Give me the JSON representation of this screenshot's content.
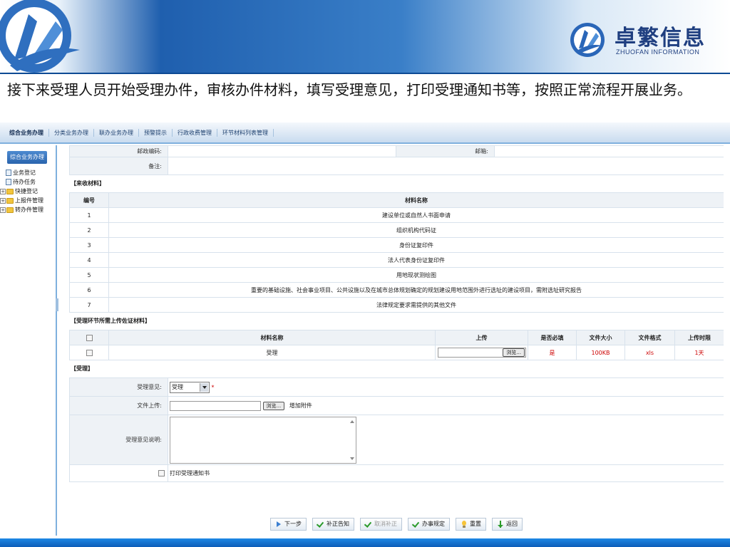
{
  "slide": {
    "brand_cn": "卓繁信息",
    "brand_en": "ZHUOFAN INFORMATION",
    "caption": "接下来受理人员开始受理办件，审核办件材料，填写受理意见，打印受理通知书等，按照正常流程开展业务。"
  },
  "topnav": {
    "items": [
      "综合业务办理",
      "分类业务办理",
      "联办业务办理",
      "预警提示",
      "行政收费管理",
      "环节材料列表管理"
    ]
  },
  "sidebar": {
    "title": "综合业务办理",
    "items": [
      {
        "label": "业务登记"
      },
      {
        "label": "待办任务"
      },
      {
        "label": "快捷登记"
      },
      {
        "label": "上报件管理"
      },
      {
        "label": "转办件管理"
      }
    ]
  },
  "form_top": {
    "postcode_label": "邮政编码:",
    "email_label": "邮箱:",
    "remark_label": "备注:"
  },
  "received_materials": {
    "section_title": "【来收材料】",
    "col_no": "编号",
    "col_name": "材料名称",
    "rows": [
      {
        "no": "1",
        "name": "建设单位或自然人书面申请"
      },
      {
        "no": "2",
        "name": "组织机构代码证"
      },
      {
        "no": "3",
        "name": "身份证复印件"
      },
      {
        "no": "4",
        "name": "法人代表身份证复印件"
      },
      {
        "no": "5",
        "name": "用地现状测绘图"
      },
      {
        "no": "6",
        "name": "重要的基础设施、社会事业项目、公共设施以及在城市总体规划确定的规划建设用地范围外进行选址的建设项目，需附选址研究报告"
      },
      {
        "no": "7",
        "name": "法律规定要求需提供的其他文件"
      }
    ]
  },
  "upload_materials": {
    "section_title": "【受理环节所需上传佐证材料】",
    "col_name": "材料名称",
    "col_upload": "上传",
    "col_required": "是否必填",
    "col_size": "文件大小",
    "col_format": "文件格式",
    "col_limit": "上传时限",
    "row": {
      "name": "受理",
      "browse": "浏览...",
      "required": "是",
      "size": "100KB",
      "format": "xls",
      "limit": "1天"
    }
  },
  "accept": {
    "section_title": "【受理】",
    "opinion_label": "受理意见:",
    "opinion_value": "受理",
    "required_mark": "*",
    "file_label": "文件上传:",
    "browse": "浏览...",
    "add_attachment": "增加附件",
    "desc_label": "受理意见说明:",
    "print_label": "打印受理通知书"
  },
  "actions": {
    "next": "下一步",
    "supplement_notice": "补正告知",
    "cancel_supplement": "取消补正",
    "handle_rule": "办事规定",
    "reset": "重置",
    "back": "返回"
  },
  "colors": {
    "nav_border": "#7fb0de",
    "required_red": "#cc0000",
    "brand_blue": "#1f3f80"
  }
}
